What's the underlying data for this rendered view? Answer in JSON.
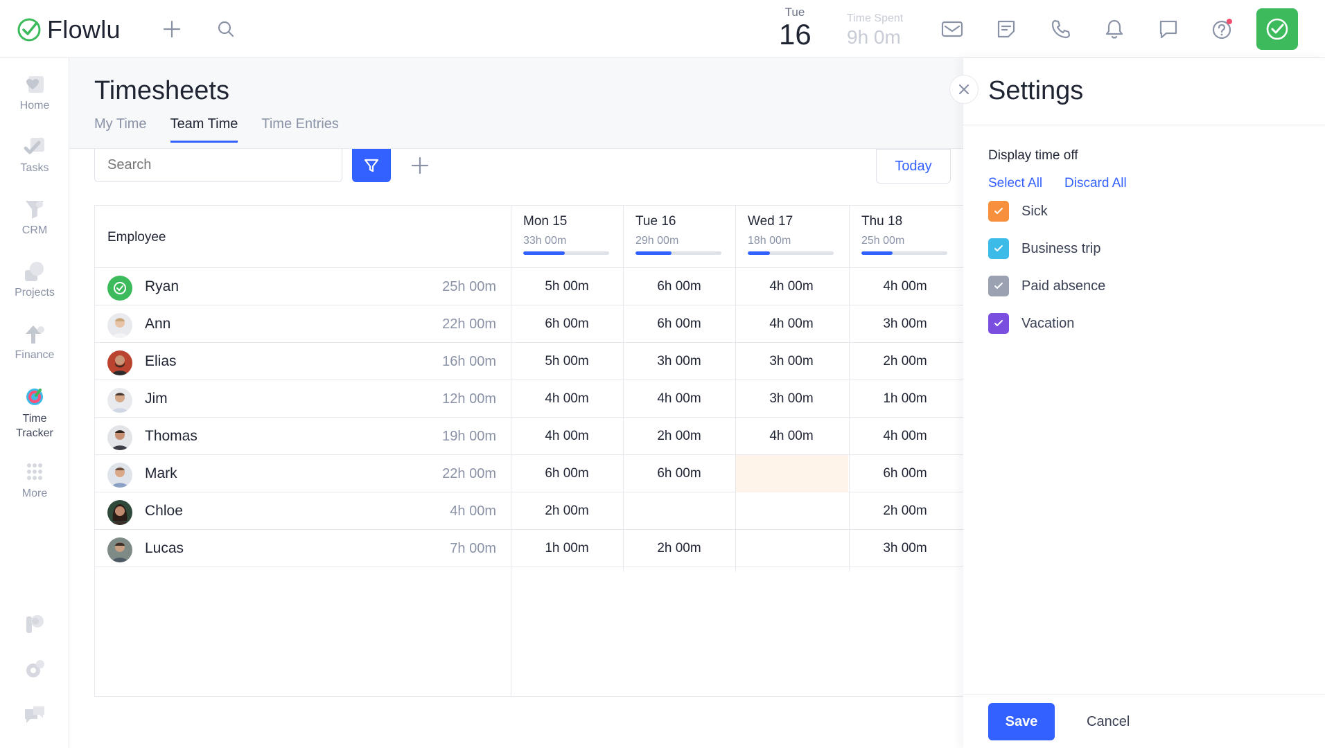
{
  "app": {
    "name": "Flowlu"
  },
  "header": {
    "date_dow": "Tue",
    "date_num": "16",
    "time_spent_label": "Time Spent",
    "time_spent_value": "9h 0m",
    "icons": [
      "plus-icon",
      "search-icon",
      "mail-icon",
      "notes-icon",
      "phone-icon",
      "bell-icon",
      "chat-icon",
      "help-icon",
      "timer-check-icon"
    ],
    "accent": "#3dbb5c"
  },
  "sidebar": {
    "items": [
      {
        "label": "Home",
        "icon": "home-icon"
      },
      {
        "label": "Tasks",
        "icon": "tasks-icon"
      },
      {
        "label": "CRM",
        "icon": "crm-icon"
      },
      {
        "label": "Projects",
        "icon": "projects-icon"
      },
      {
        "label": "Finance",
        "icon": "finance-icon"
      },
      {
        "label": "Time\nTracker",
        "icon": "time-tracker-icon"
      },
      {
        "label": "More",
        "icon": "more-icon"
      }
    ],
    "bottom_icons": [
      "pipedrive-icon",
      "settings-icon",
      "support-icon"
    ]
  },
  "page": {
    "title": "Timesheets",
    "tabs": [
      {
        "label": "My Time"
      },
      {
        "label": "Team Time",
        "active": true
      },
      {
        "label": "Time Entries"
      }
    ],
    "search_placeholder": "Search",
    "today_label": "Today",
    "primary_color": "#3361ff"
  },
  "table": {
    "employee_header": "Employee",
    "days": [
      {
        "name": "Mon 15",
        "total": "33h 00m",
        "progress": 0.48
      },
      {
        "name": "Tue 16",
        "total": "29h 00m",
        "progress": 0.42
      },
      {
        "name": "Wed 17",
        "total": "18h 00m",
        "progress": 0.26
      },
      {
        "name": "Thu 18",
        "total": "25h 00m",
        "progress": 0.36
      }
    ],
    "rows": [
      {
        "name": "Ryan",
        "total": "25h 00m",
        "cells": [
          "5h 00m",
          "6h 00m",
          "4h 00m",
          "4h 00m"
        ]
      },
      {
        "name": "Ann",
        "total": "22h 00m",
        "cells": [
          "6h 00m",
          "6h 00m",
          "4h 00m",
          "3h 00m"
        ]
      },
      {
        "name": "Elias",
        "total": "16h 00m",
        "cells": [
          "5h 00m",
          "3h 00m",
          "3h 00m",
          "2h 00m"
        ]
      },
      {
        "name": "Jim",
        "total": "12h 00m",
        "cells": [
          "4h 00m",
          "4h 00m",
          "3h 00m",
          "1h 00m"
        ]
      },
      {
        "name": "Thomas",
        "total": "19h 00m",
        "cells": [
          "4h 00m",
          "2h 00m",
          "4h 00m",
          "4h 00m"
        ]
      },
      {
        "name": "Mark",
        "total": "22h 00m",
        "cells": [
          "6h 00m",
          "6h 00m",
          "",
          "6h 00m"
        ]
      },
      {
        "name": "Chloe",
        "total": "4h 00m",
        "cells": [
          "2h 00m",
          "",
          "",
          "2h 00m"
        ]
      },
      {
        "name": "Lucas",
        "total": "7h 00m",
        "cells": [
          "1h 00m",
          "2h 00m",
          "",
          "3h 00m"
        ]
      }
    ]
  },
  "settings": {
    "title": "Settings",
    "section_title": "Display time off",
    "select_all": "Select All",
    "discard_all": "Discard All",
    "options": [
      {
        "label": "Sick",
        "color": "#f7903c",
        "checked": true
      },
      {
        "label": "Business trip",
        "color": "#3dbbe8",
        "checked": true
      },
      {
        "label": "Paid absence",
        "color": "#9aa2b1",
        "checked": true
      },
      {
        "label": "Vacation",
        "color": "#7a4fe0",
        "checked": true
      }
    ],
    "save_label": "Save",
    "cancel_label": "Cancel"
  }
}
